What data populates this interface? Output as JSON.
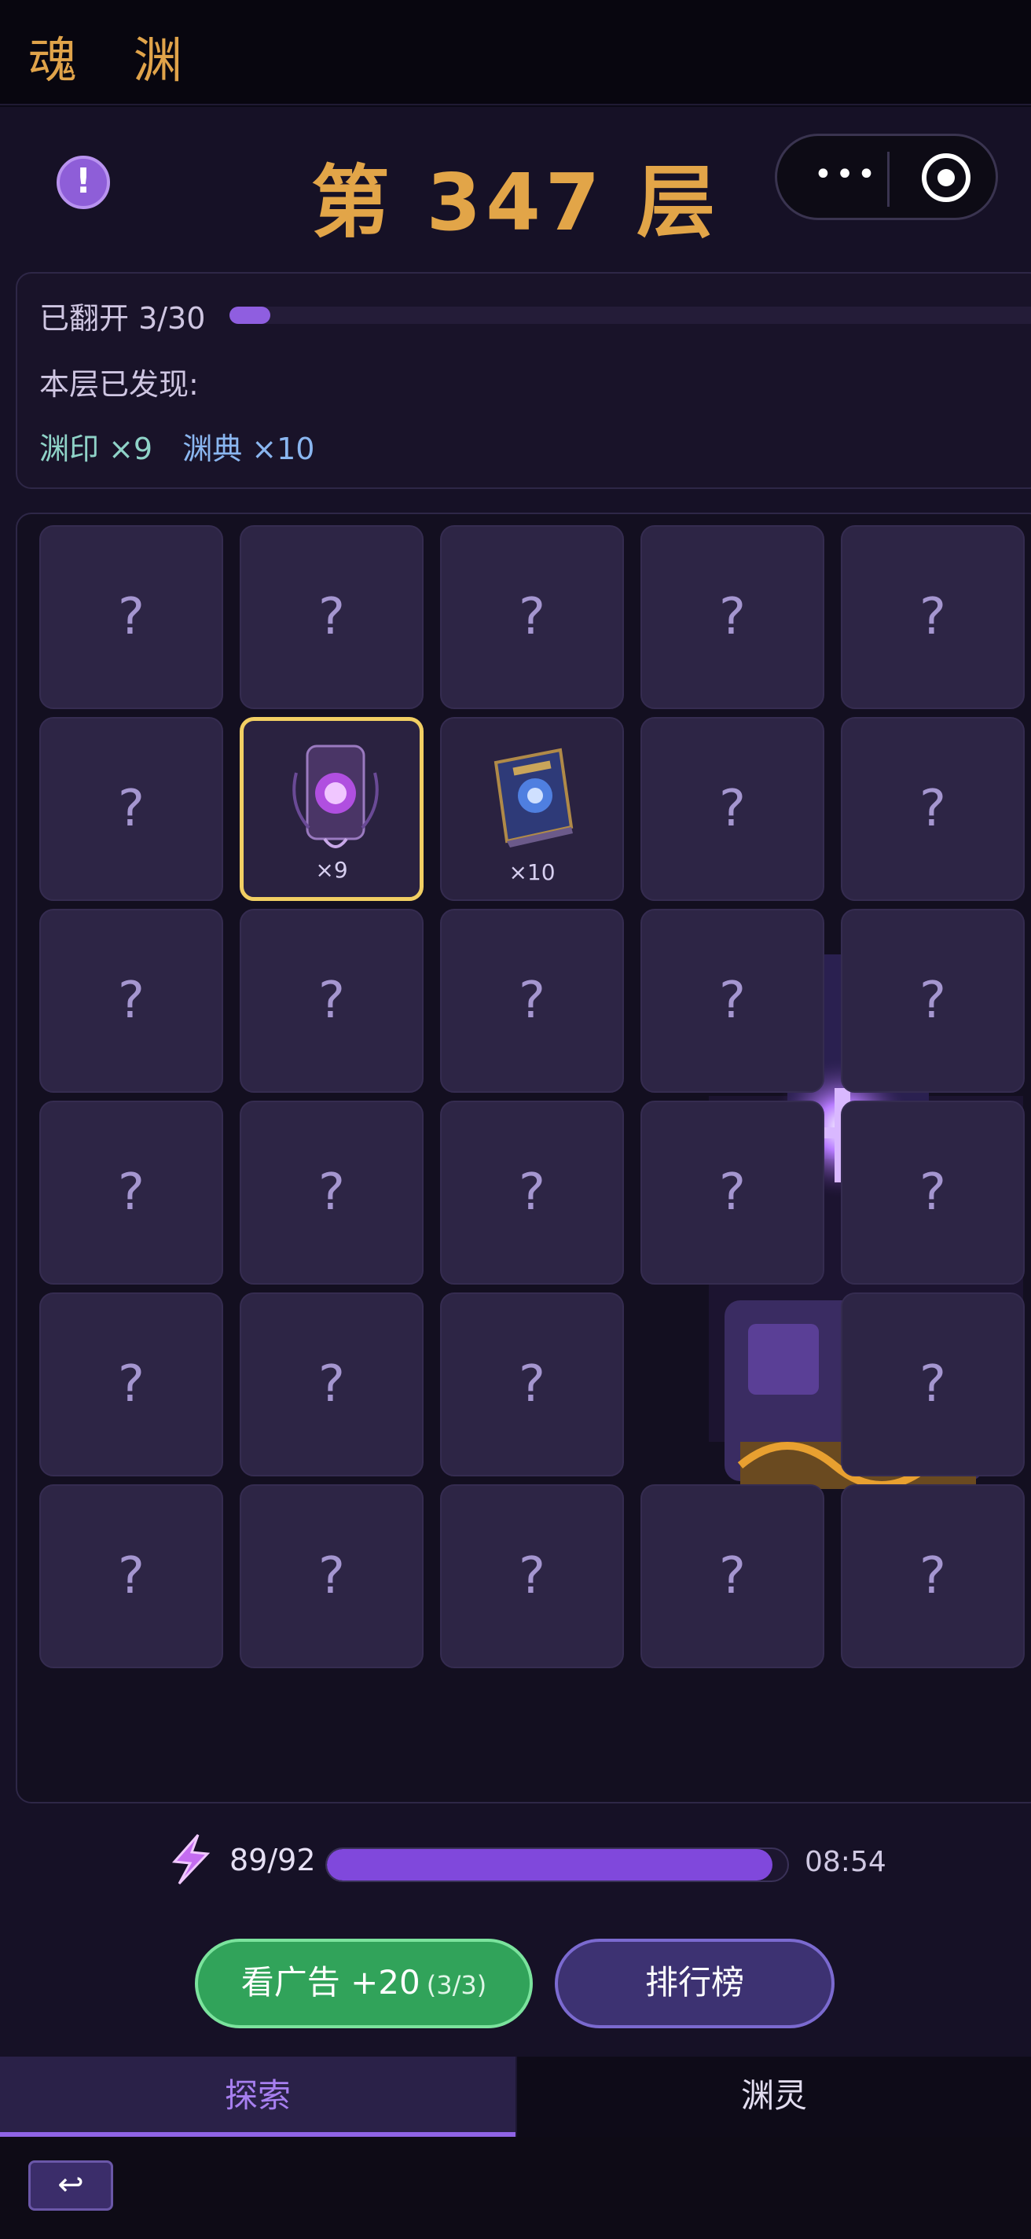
{
  "app": {
    "title": "魂 渊"
  },
  "header": {
    "info_icon": "!",
    "floor_title": "第 347 层",
    "more_label": "•••"
  },
  "progress": {
    "flipped_label": "已翻开 3/30",
    "flipped_fraction": 0.1,
    "found_label": "本层已发现:",
    "found_a": "渊印 ×9",
    "found_b": "渊典 ×10"
  },
  "grid": {
    "question_mark": "?",
    "revealed": [
      {
        "item_icon": "seal-card-icon",
        "count": "×9"
      },
      {
        "item_icon": "tome-book-icon",
        "count": "×10"
      }
    ]
  },
  "energy": {
    "value": "89/92",
    "fraction": 0.967,
    "timer": "08:54"
  },
  "actions": {
    "ad_label": "看广告 +20",
    "ad_count": "(3/3)",
    "rank_label": "排行榜"
  },
  "tabs": {
    "explore": "探索",
    "spirits": "渊灵"
  },
  "colors": {
    "accent": "#8f5ee0",
    "gold": "#e2a548",
    "green": "#31a35a",
    "selected_border": "#f2cf63"
  }
}
